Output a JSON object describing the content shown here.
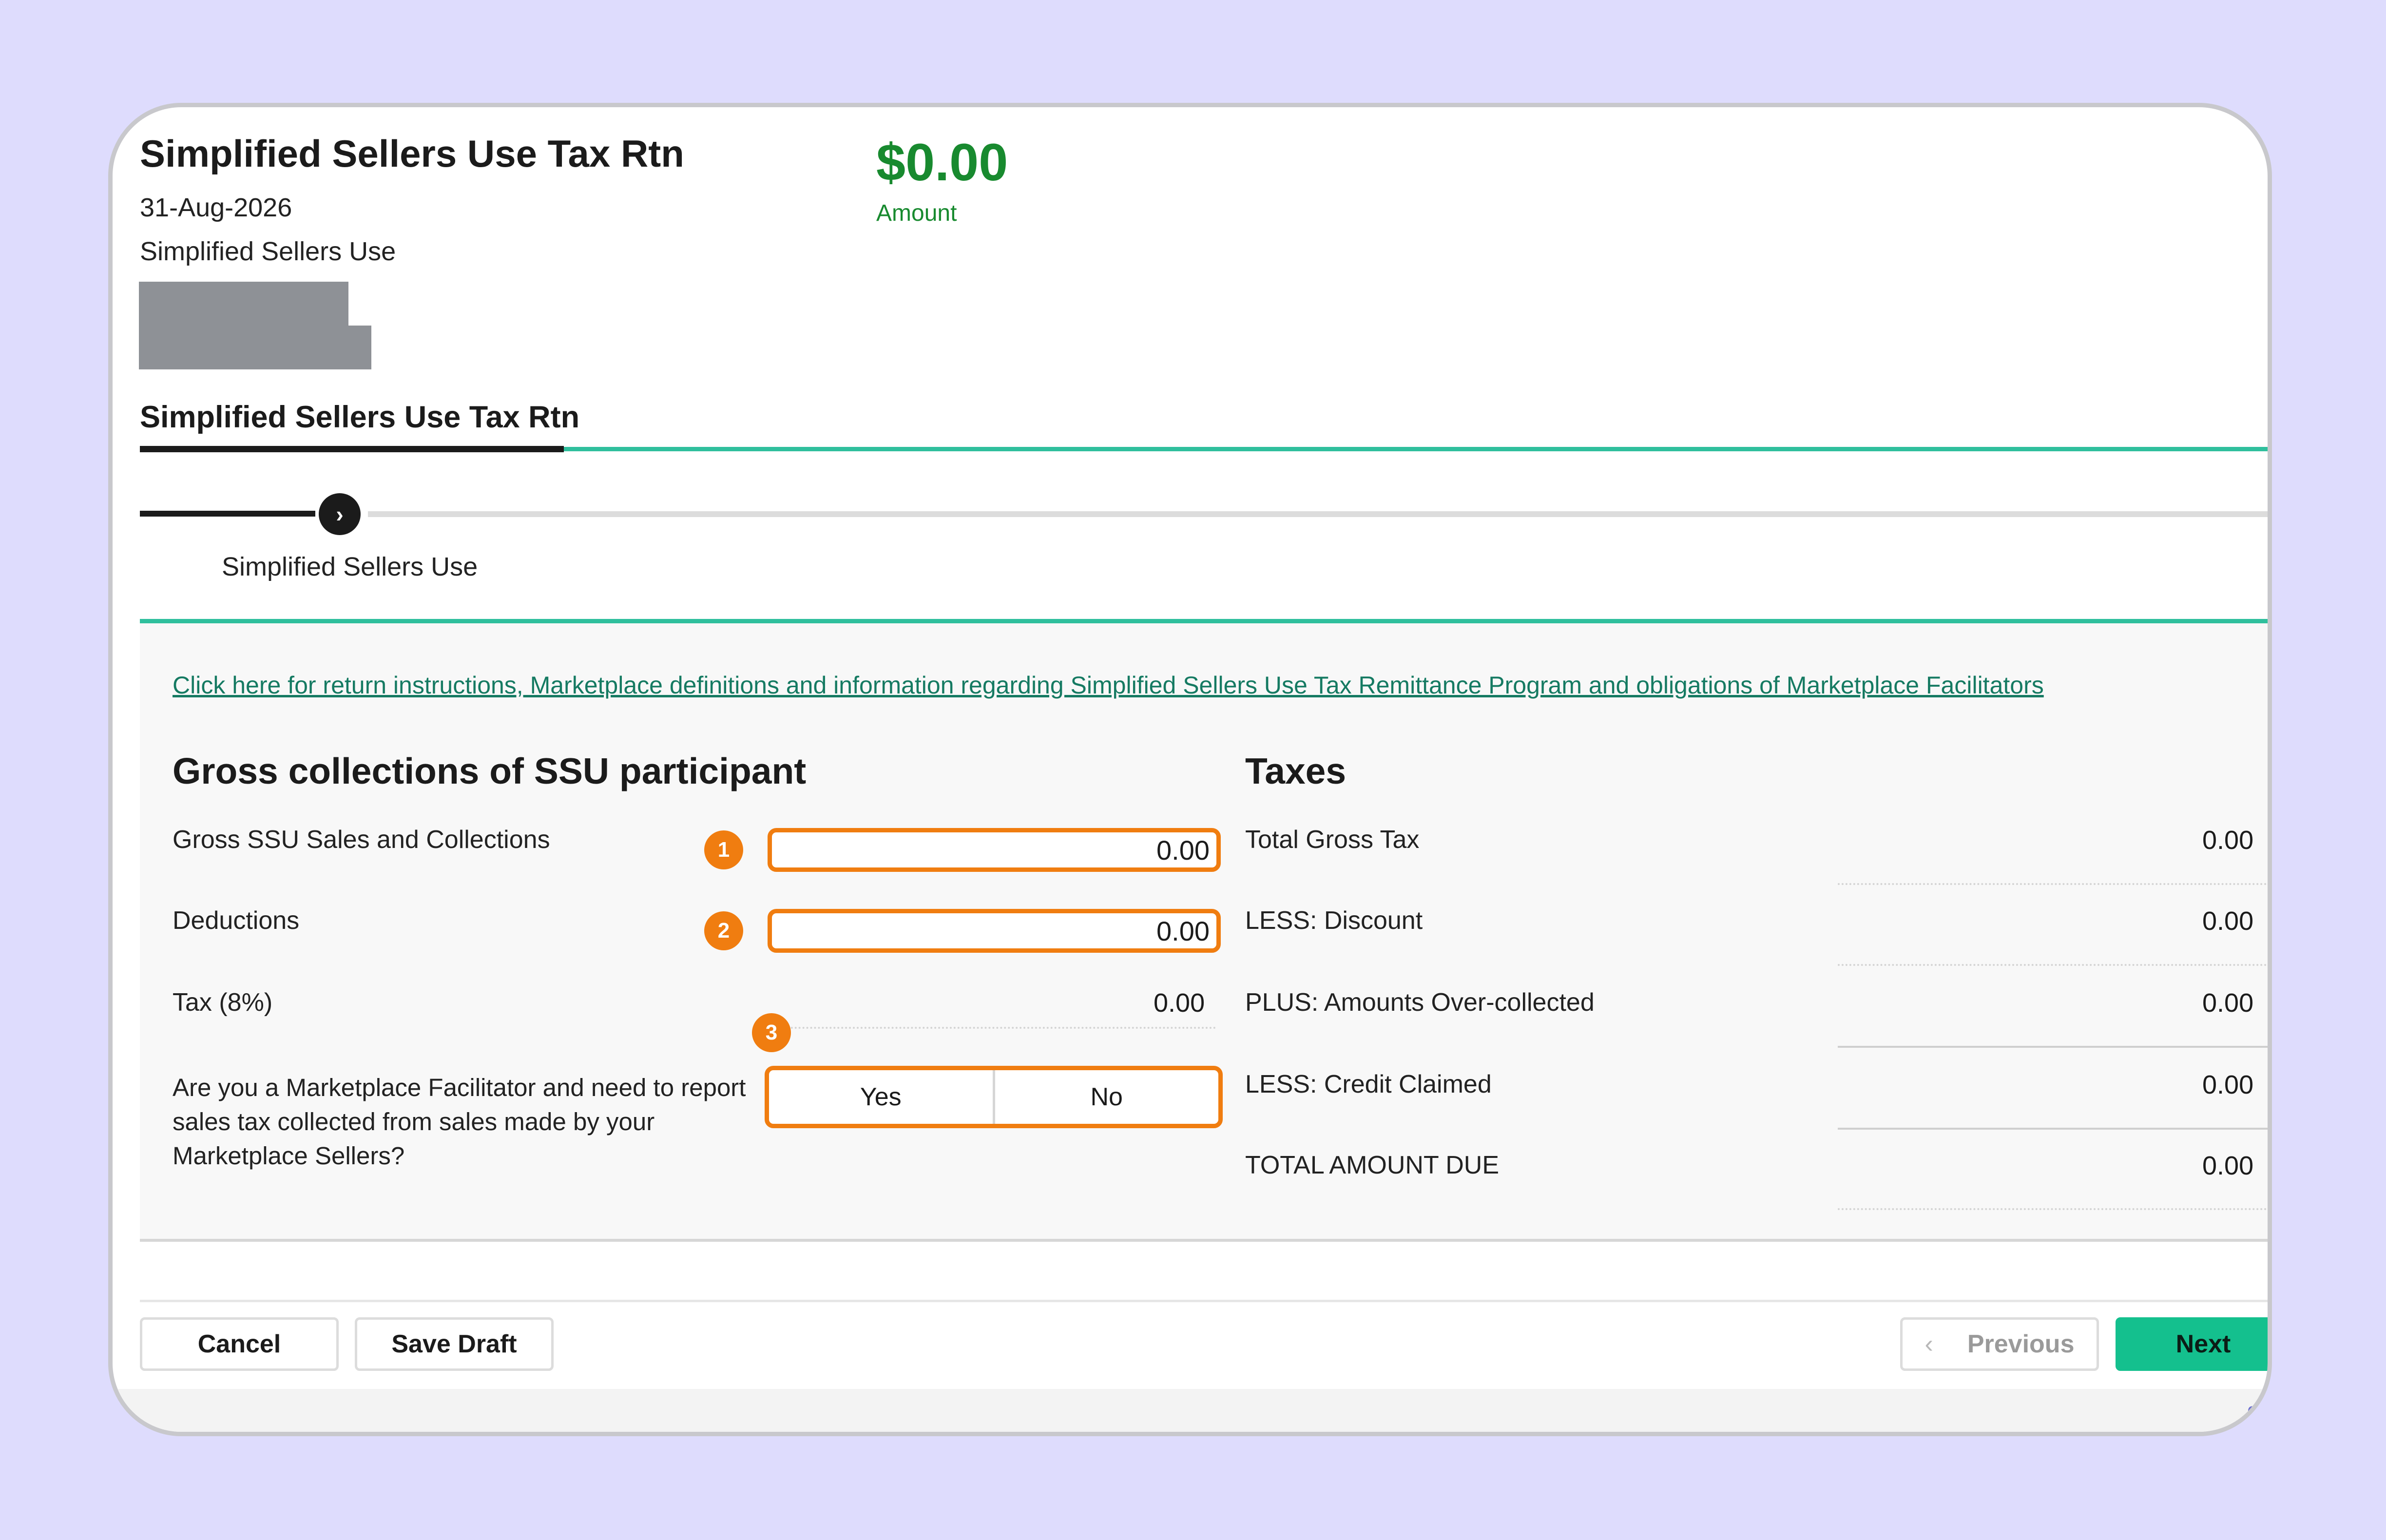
{
  "header": {
    "title": "Simplified Sellers Use Tax Rtn",
    "date": "31-Aug-2026",
    "return_type": "Simplified Sellers Use",
    "amount": "$0.00",
    "amount_label": "Amount"
  },
  "tabs": [
    {
      "label": "Simplified Sellers Use Tax Rtn",
      "active": true
    }
  ],
  "stepper": {
    "current_step_label": "Simplified Sellers Use",
    "chevron": "chevron-right-icon"
  },
  "form": {
    "instructions_link": "Click here for return instructions, Marketplace definitions and information regarding Simplified Sellers Use Tax Remittance Program and obligations of Marketplace Facilitators",
    "left_heading": "Gross collections of SSU participant",
    "right_heading": "Taxes",
    "gross_sales": {
      "label": "Gross SSU Sales and Collections",
      "value": "0.00",
      "badge": "1"
    },
    "deductions": {
      "label": "Deductions",
      "value": "0.00",
      "badge": "2"
    },
    "tax": {
      "label": "Tax (8%)",
      "value": "0.00"
    },
    "marketplace": {
      "question": "Are you a Marketplace Facilitator and need to report sales tax collected from sales made by your Marketplace Sellers?",
      "badge": "3",
      "options": [
        "Yes",
        "No"
      ]
    },
    "taxes": [
      {
        "label": "Total Gross Tax",
        "value": "0.00"
      },
      {
        "label": "LESS: Discount",
        "value": "0.00"
      },
      {
        "label": "PLUS: Amounts Over-collected",
        "value": "0.00"
      },
      {
        "label": "LESS: Credit Claimed",
        "value": "0.00"
      },
      {
        "label": "TOTAL AMOUNT DUE",
        "value": "0.00"
      }
    ]
  },
  "footer": {
    "cancel_label": "Cancel",
    "save_draft_label": "Save Draft",
    "previous_label": "Previous",
    "next_label": "Next",
    "corner_text": "g"
  },
  "colors": {
    "accent_teal": "#2fbf9d",
    "highlight_orange": "#f07d10",
    "amount_green": "#188a2f",
    "next_button": "#14c08e",
    "background": "#dedcfd"
  }
}
